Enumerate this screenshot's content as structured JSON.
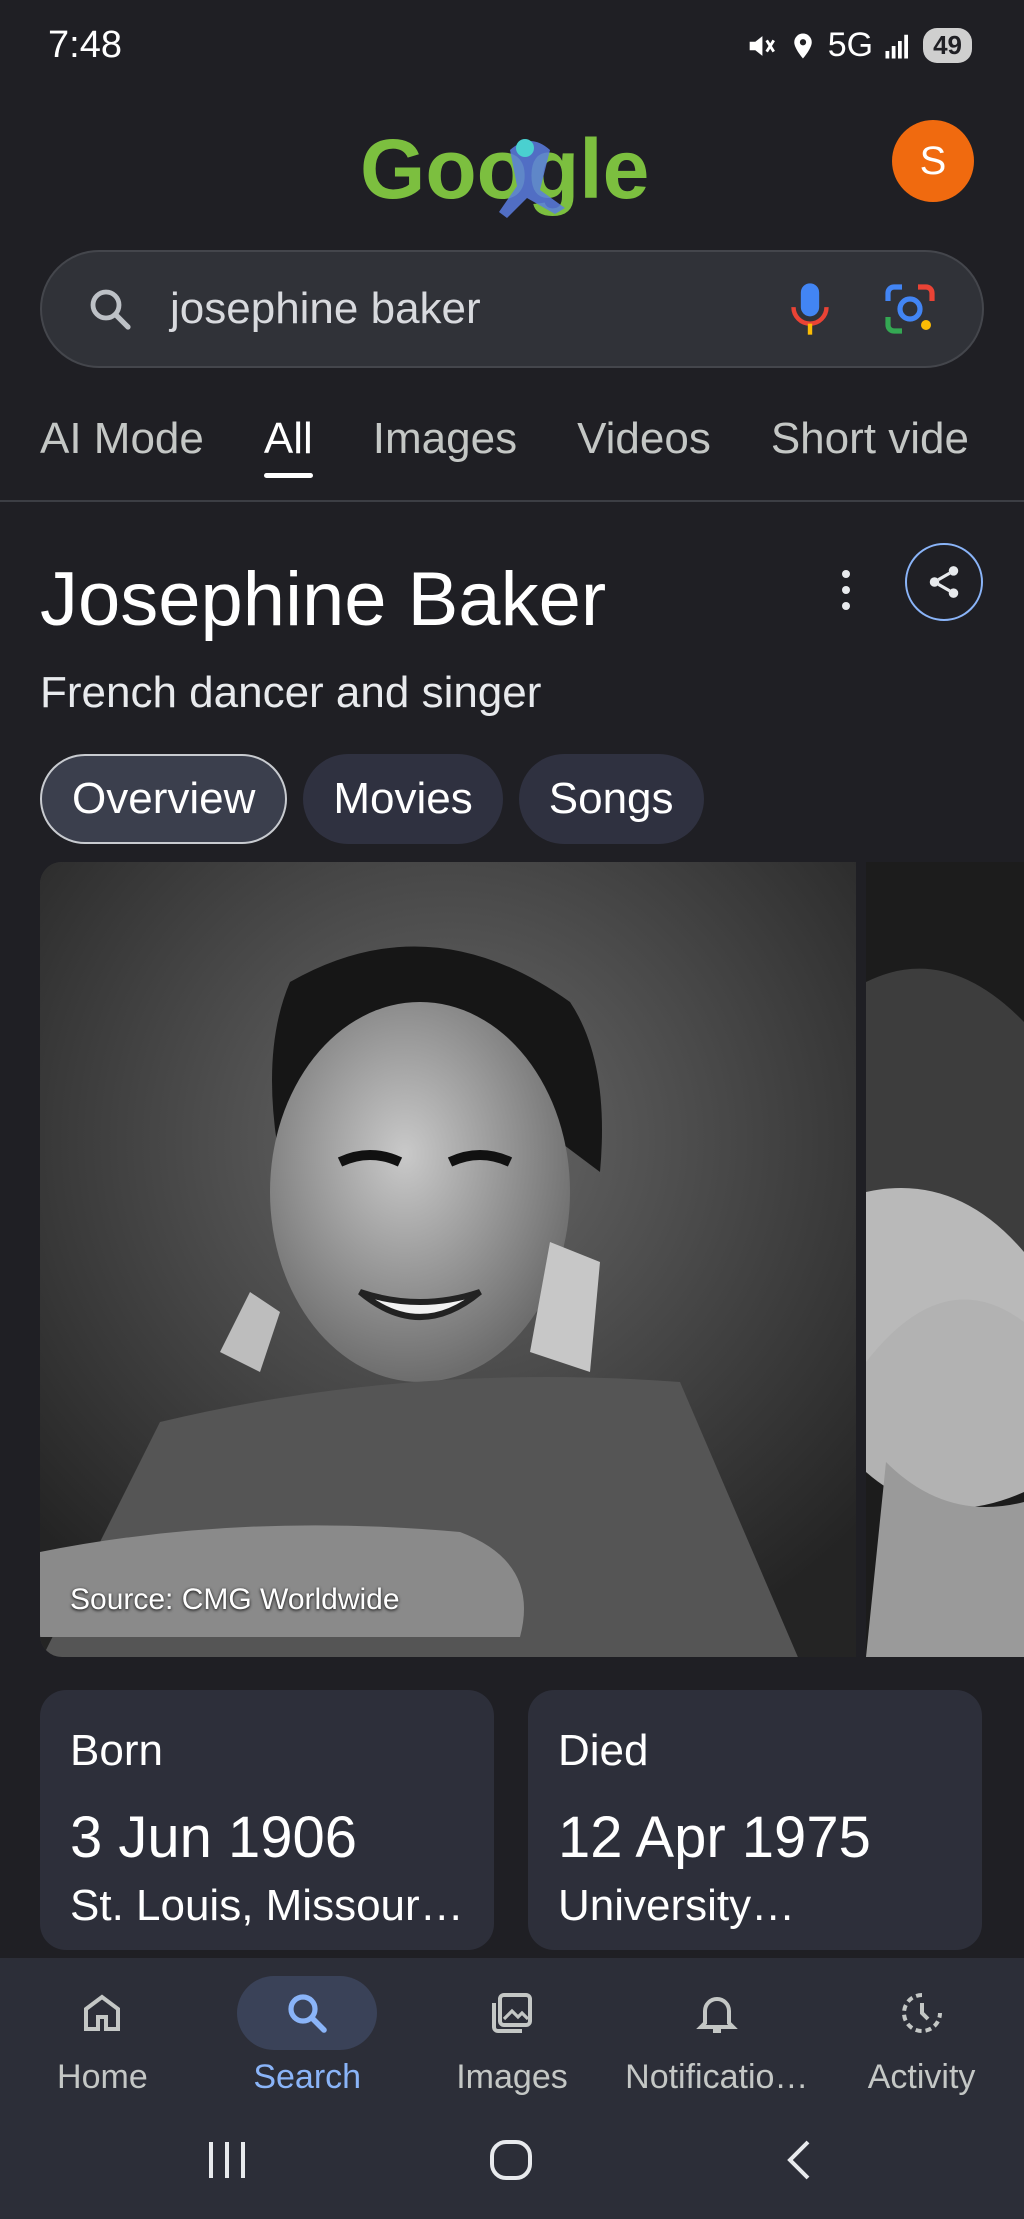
{
  "status_bar": {
    "time": "7:48",
    "network": "5G",
    "battery": "49"
  },
  "header": {
    "logo_text": "Google",
    "avatar_initial": "S"
  },
  "search": {
    "query": "josephine baker"
  },
  "tabs": [
    {
      "label": "AI Mode"
    },
    {
      "label": "All"
    },
    {
      "label": "Images"
    },
    {
      "label": "Videos"
    },
    {
      "label": "Short vide"
    }
  ],
  "panel": {
    "title": "Josephine Baker",
    "subtitle": "French dancer and singer",
    "chips": [
      {
        "label": "Overview"
      },
      {
        "label": "Movies"
      },
      {
        "label": "Songs"
      }
    ],
    "image_source": "Source: CMG Worldwide",
    "born": {
      "label": "Born",
      "date": "3 Jun 1906",
      "place": "St. Louis, Missouri…"
    },
    "died": {
      "label": "Died",
      "date": "12 Apr 1975",
      "place": "University…"
    }
  },
  "bottom_nav": [
    {
      "label": "Home",
      "icon": "home-icon"
    },
    {
      "label": "Search",
      "icon": "search-icon"
    },
    {
      "label": "Images",
      "icon": "images-icon"
    },
    {
      "label": "Notificatio…",
      "icon": "bell-icon"
    },
    {
      "label": "Activity",
      "icon": "activity-icon"
    }
  ],
  "colors": {
    "background": "#1f1f24",
    "accent": "#8ab4f8",
    "avatar": "#f06a0f"
  }
}
